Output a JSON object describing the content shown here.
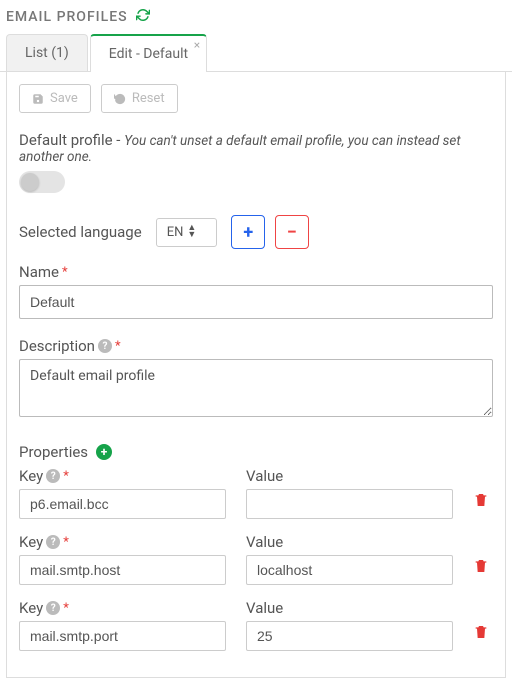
{
  "title": "EMAIL PROFILES",
  "tabs": {
    "list": "List (1)",
    "edit": "Edit - Default"
  },
  "toolbar": {
    "save": "Save",
    "reset": "Reset"
  },
  "defaultProfile": {
    "label": "Default profile - ",
    "note": "You can't unset a default email profile, you can instead set another one."
  },
  "language": {
    "label": "Selected language",
    "selected": "EN"
  },
  "name": {
    "label": "Name",
    "value": "Default"
  },
  "description": {
    "label": "Description",
    "value": "Default email profile"
  },
  "properties": {
    "label": "Properties",
    "keyLabel": "Key",
    "valueLabel": "Value",
    "rows": [
      {
        "key": "p6.email.bcc",
        "value": ""
      },
      {
        "key": "mail.smtp.host",
        "value": "localhost"
      },
      {
        "key": "mail.smtp.port",
        "value": "25"
      }
    ]
  }
}
